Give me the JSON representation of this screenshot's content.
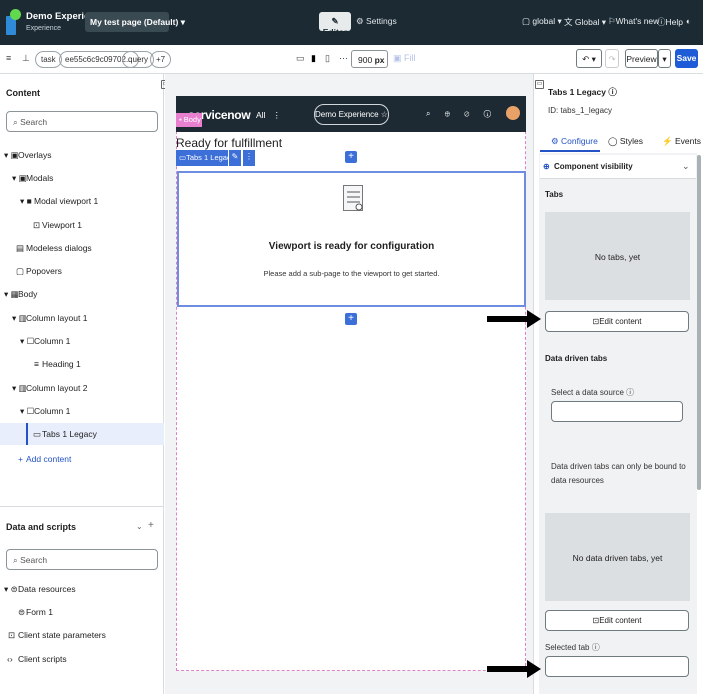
{
  "topbar": {
    "app_name": "Demo Experience",
    "app_sub": "Experience",
    "page_select": "My test page (Default)",
    "page_select_caret": "▾",
    "editor": "Editor",
    "settings": "Settings",
    "scope": "global ▾",
    "language": "Global ▾",
    "whats_new": "What's new",
    "help": "Help",
    "contrast_icon": "◐"
  },
  "toolbar": {
    "menu_icon": "≡",
    "record_icon": "⊥",
    "chip_task": "task",
    "chip_sysid": "ee55c6c9c09702...",
    "chip_query": "query",
    "chip_more": "+7",
    "width_value": "900",
    "width_unit": "px",
    "fill": "Fill",
    "undo": "↶",
    "undo_caret": "▾",
    "redo": "↷",
    "preview": "Preview",
    "preview_caret": "▾",
    "save": "Save"
  },
  "content_panel": {
    "title": "Content",
    "search_placeholder": "Search",
    "tree": [
      {
        "label": "Overlays",
        "prefix": "▾ ▣"
      },
      {
        "label": "Modals",
        "prefix": "▾ ▣"
      },
      {
        "label": "Modal viewport 1",
        "prefix": "▾ ■"
      },
      {
        "label": "Viewport 1",
        "prefix": "⊡"
      },
      {
        "label": "Modeless dialogs",
        "prefix": "▤"
      },
      {
        "label": "Popovers",
        "prefix": "▢"
      },
      {
        "label": "Body",
        "prefix": "▾ ▦"
      },
      {
        "label": "Column layout 1",
        "prefix": "▾ ▥"
      },
      {
        "label": "Column 1",
        "prefix": "▾ ☐"
      },
      {
        "label": "Heading 1",
        "prefix": "≡"
      },
      {
        "label": "Column layout 2",
        "prefix": "▾ ▥"
      },
      {
        "label": "Column 1",
        "prefix": "▾ ☐"
      },
      {
        "label": "Tabs 1 Legacy",
        "prefix": "▭"
      },
      {
        "label": "Add content",
        "prefix": "+"
      }
    ]
  },
  "data_panel": {
    "title": "Data and scripts",
    "search_placeholder": "Search",
    "tree": [
      {
        "label": "Data resources",
        "prefix": "▾ ⊜"
      },
      {
        "label": "Form 1",
        "prefix": "⊜"
      },
      {
        "label": "Client state parameters",
        "prefix": "⊡"
      },
      {
        "label": "Client scripts",
        "prefix": "‹›"
      }
    ]
  },
  "canvas": {
    "brand": "servicenow",
    "all": "All",
    "experience_pill": "Demo Experience ☆",
    "header_icons": "⌕ ⊕ ⊘ ⓘ ♫",
    "body_tag": "Body",
    "heading": "Ready for fulfillment",
    "tabs_tag": "Tabs 1 Legacy",
    "viewport_title": "Viewport is ready for configuration",
    "viewport_sub": "Please add a sub-page to the viewport to get started."
  },
  "config_panel": {
    "title": "Tabs 1 Legacy",
    "id": "ID: tabs_1_legacy",
    "tabs": [
      "Configure",
      "Styles",
      "Events"
    ],
    "component_visibility": "Component visibility",
    "tabs_label": "Tabs",
    "no_tabs": "No tabs, yet",
    "edit_content": "Edit content",
    "data_driven_tabs": "Data driven tabs",
    "select_source": "Select a data source",
    "bound_note": "Data driven tabs can only be bound to data resources",
    "no_data_tabs": "No data driven tabs, yet",
    "edit_content_2": "Edit content",
    "selected_tab": "Selected tab"
  }
}
